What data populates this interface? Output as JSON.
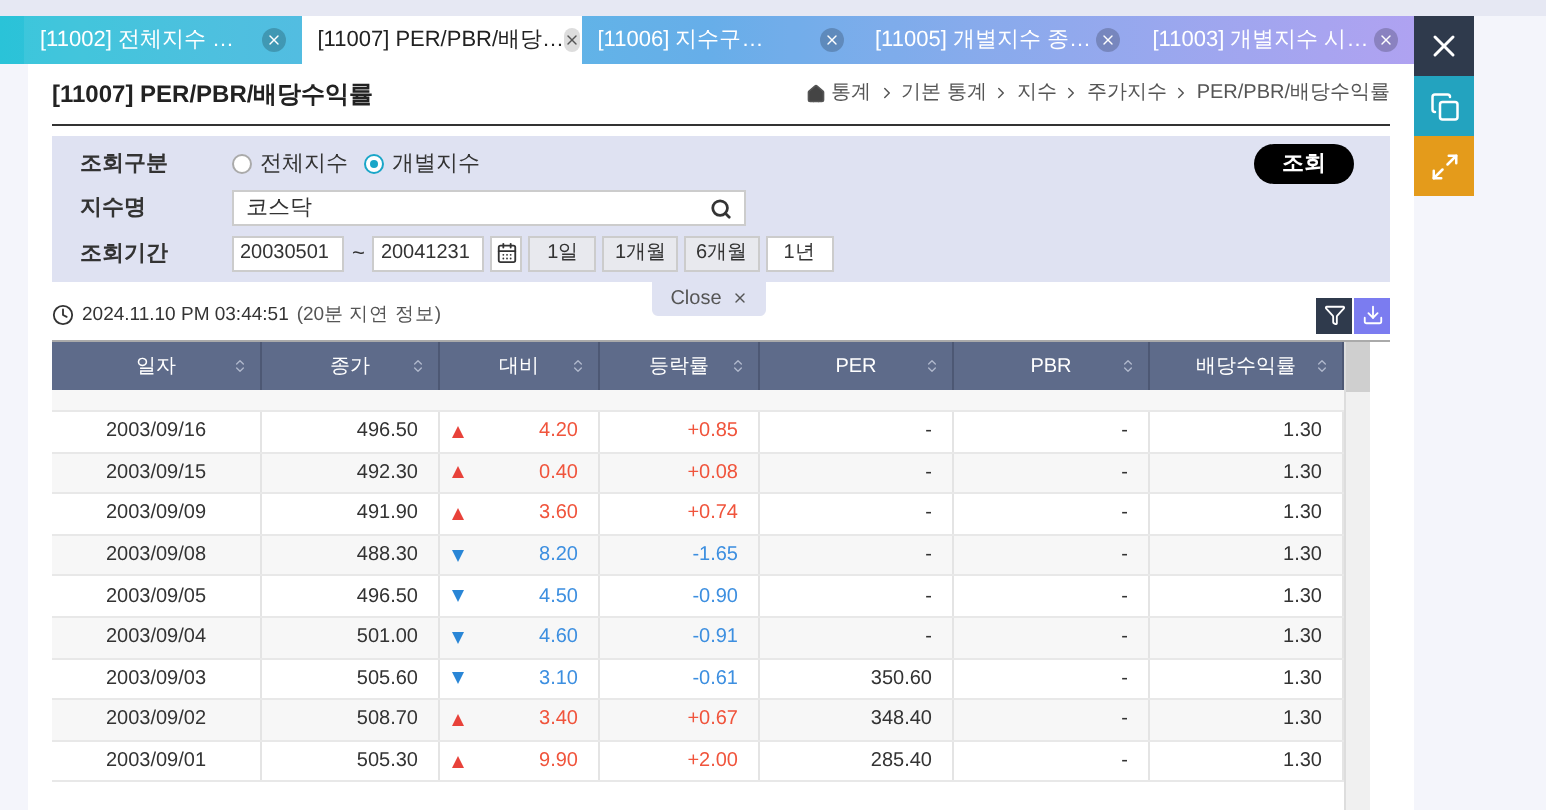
{
  "tabs": [
    {
      "label": "[11002] 전체지수 …",
      "selected": false
    },
    {
      "label": "[11007] PER/PBR/배당…",
      "selected": true
    },
    {
      "label": "[11006] 지수구…",
      "selected": false
    },
    {
      "label": "[11005] 개별지수 종…",
      "selected": false
    },
    {
      "label": "[11003] 개별지수 시…",
      "selected": false
    }
  ],
  "page_title": "[11007] PER/PBR/배당수익률",
  "breadcrumb": [
    "통계",
    "기본 통계",
    "지수",
    "주가지수",
    "PER/PBR/배당수익률"
  ],
  "filter": {
    "type_label": "조회구분",
    "options": [
      {
        "label": "전체지수",
        "selected": false
      },
      {
        "label": "개별지수",
        "selected": true
      }
    ],
    "name_label": "지수명",
    "name_value": "코스닥",
    "period_label": "조회기간",
    "start_date": "20030501",
    "separator": "~",
    "end_date": "20041231",
    "period_buttons": [
      "1일",
      "1개월",
      "6개월",
      "1년"
    ],
    "search_button": "조회",
    "close_button": "Close"
  },
  "timestamp": "2024.11.10 PM 03:44:51",
  "delay_note": "(20분 지연 정보)",
  "table": {
    "columns": [
      "일자",
      "종가",
      "대비",
      "등락률",
      "PER",
      "PBR",
      "배당수익률"
    ],
    "rows": [
      {
        "date": "2003/09/16",
        "close": "496.50",
        "kind": "up",
        "change": "4.20",
        "rate": "+0.85",
        "per": "-",
        "pbr": "-",
        "yield": "1.30"
      },
      {
        "date": "2003/09/15",
        "close": "492.30",
        "kind": "up",
        "change": "0.40",
        "rate": "+0.08",
        "per": "-",
        "pbr": "-",
        "yield": "1.30"
      },
      {
        "date": "2003/09/09",
        "close": "491.90",
        "kind": "up",
        "change": "3.60",
        "rate": "+0.74",
        "per": "-",
        "pbr": "-",
        "yield": "1.30"
      },
      {
        "date": "2003/09/08",
        "close": "488.30",
        "kind": "down",
        "change": "8.20",
        "rate": "-1.65",
        "per": "-",
        "pbr": "-",
        "yield": "1.30"
      },
      {
        "date": "2003/09/05",
        "close": "496.50",
        "kind": "down",
        "change": "4.50",
        "rate": "-0.90",
        "per": "-",
        "pbr": "-",
        "yield": "1.30"
      },
      {
        "date": "2003/09/04",
        "close": "501.00",
        "kind": "down",
        "change": "4.60",
        "rate": "-0.91",
        "per": "-",
        "pbr": "-",
        "yield": "1.30"
      },
      {
        "date": "2003/09/03",
        "close": "505.60",
        "kind": "down",
        "change": "3.10",
        "rate": "-0.61",
        "per": "350.60",
        "pbr": "-",
        "yield": "1.30"
      },
      {
        "date": "2003/09/02",
        "close": "508.70",
        "kind": "up",
        "change": "3.40",
        "rate": "+0.67",
        "per": "348.40",
        "pbr": "-",
        "yield": "1.30"
      },
      {
        "date": "2003/09/01",
        "close": "505.30",
        "kind": "up",
        "change": "9.90",
        "rate": "+2.00",
        "per": "285.40",
        "pbr": "-",
        "yield": "1.30"
      }
    ]
  }
}
